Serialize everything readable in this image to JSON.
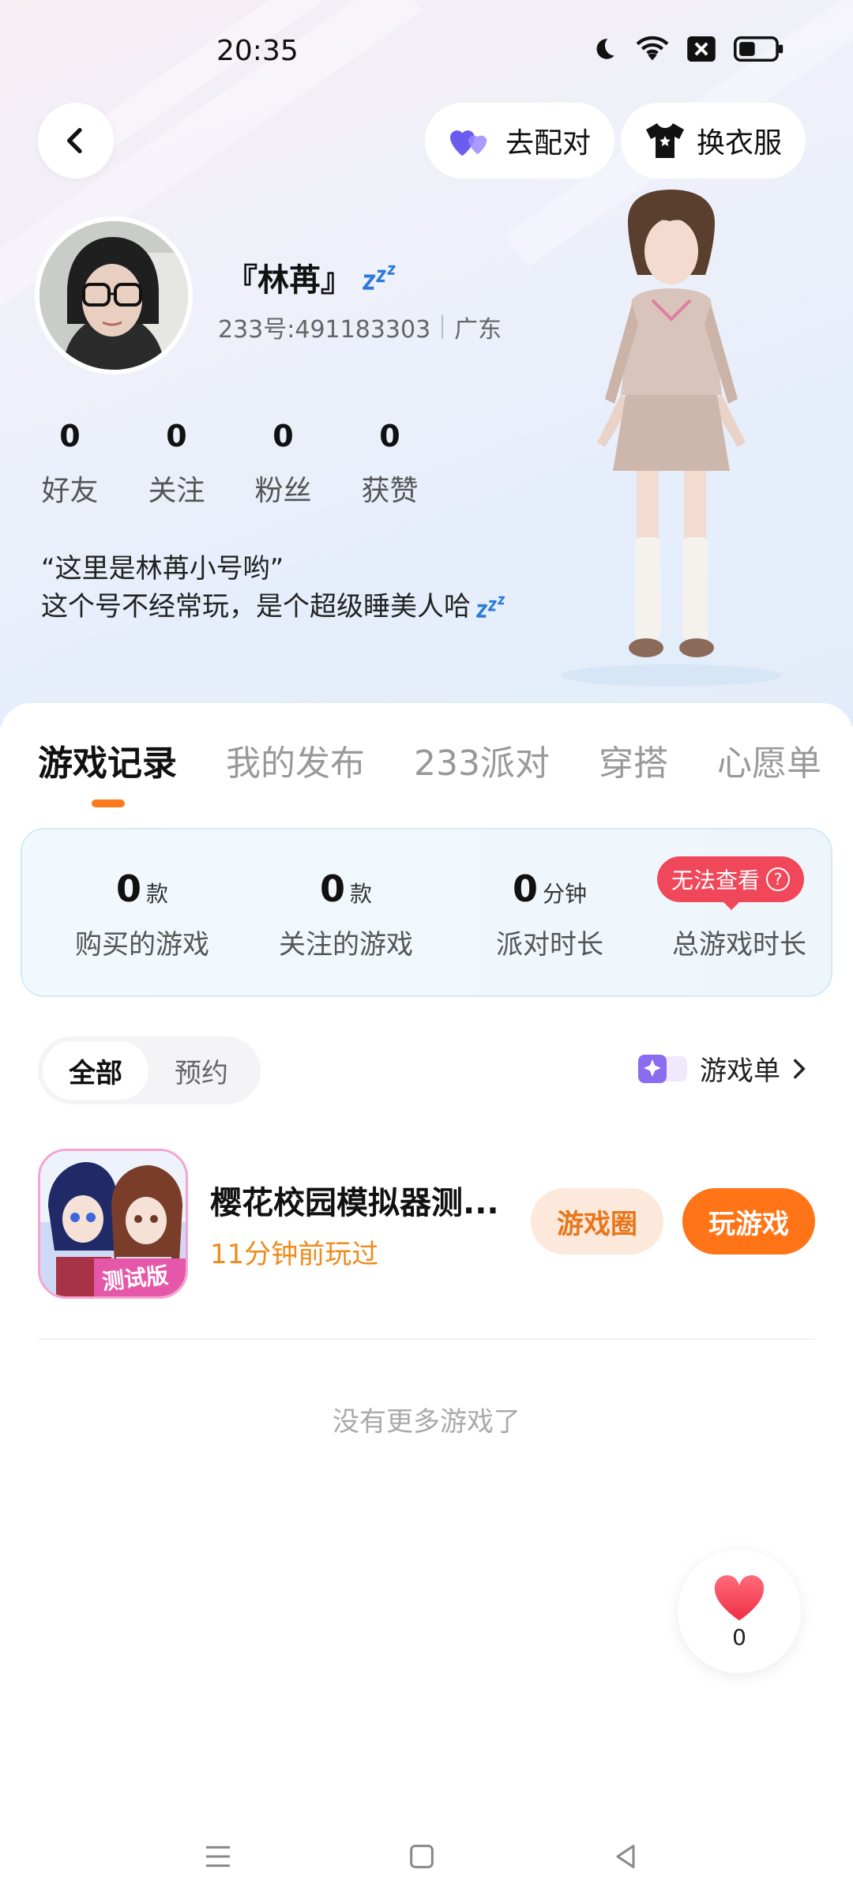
{
  "status_bar": {
    "time": "20:35"
  },
  "header": {
    "match_label": "去配对",
    "outfit_label": "换衣服"
  },
  "profile": {
    "name": "『林苒』",
    "uid": "233号:491183303",
    "region": "广东",
    "stats": [
      {
        "value": "0",
        "label": "好友"
      },
      {
        "value": "0",
        "label": "关注"
      },
      {
        "value": "0",
        "label": "粉丝"
      },
      {
        "value": "0",
        "label": "获赞"
      }
    ],
    "bio_line1": "“这里是林苒小号哟”",
    "bio_line2": "这个号不经常玩，是个超级睡美人哈"
  },
  "tabs": [
    "游戏记录",
    "我的发布",
    "233派对",
    "穿搭",
    "心愿单"
  ],
  "summary": {
    "purchased": {
      "value": "0",
      "unit": "款",
      "label": "购买的游戏"
    },
    "followed": {
      "value": "0",
      "unit": "款",
      "label": "关注的游戏"
    },
    "party": {
      "value": "0",
      "unit": "分钟",
      "label": "派对时长"
    },
    "total": {
      "badge": "无法查看",
      "label": "总游戏时长"
    }
  },
  "filter": {
    "all": "全部",
    "reserve": "预约"
  },
  "game_list_link": "游戏单",
  "game": {
    "title": "樱花校园模拟器测...",
    "subtitle": "11分钟前玩过",
    "icon_badge": "测试版",
    "circle_button": "游戏圈",
    "play_button": "玩游戏"
  },
  "no_more": "没有更多游戏了",
  "like": {
    "count": "0"
  },
  "colors": {
    "accent": "#ff7416",
    "badge": "#f0485a",
    "subtitle": "#f08a1c"
  }
}
